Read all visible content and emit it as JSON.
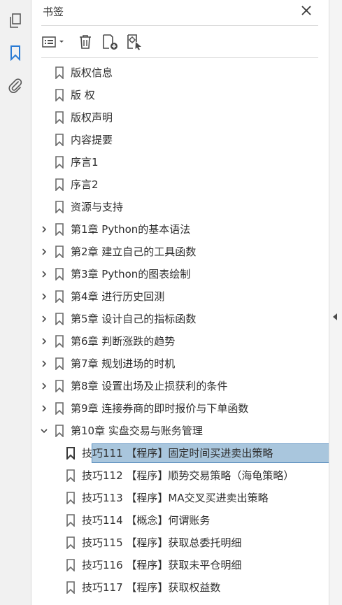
{
  "panel": {
    "title": "书签"
  },
  "rail": {
    "items": [
      {
        "icon": "pages-icon",
        "active": false
      },
      {
        "icon": "bookmark-icon",
        "active": true
      },
      {
        "icon": "attachment-icon",
        "active": false
      }
    ]
  },
  "toolbar": {
    "buttons": [
      "options-menu-icon",
      "delete-bookmark-icon",
      "new-bookmark-icon",
      "new-bookmark-from-structure-icon"
    ]
  },
  "bookmarks": [
    {
      "label": "版权信息",
      "level": 0,
      "expandable": false
    },
    {
      "label": "版 权",
      "level": 0,
      "expandable": false
    },
    {
      "label": "版权声明",
      "level": 0,
      "expandable": false
    },
    {
      "label": "内容提要",
      "level": 0,
      "expandable": false
    },
    {
      "label": "序言1",
      "level": 0,
      "expandable": false
    },
    {
      "label": "序言2",
      "level": 0,
      "expandable": false
    },
    {
      "label": "资源与支持",
      "level": 0,
      "expandable": false
    },
    {
      "label": "第1章 Python的基本语法",
      "level": 0,
      "expandable": true,
      "expanded": false
    },
    {
      "label": "第2章 建立自己的工具函数",
      "level": 0,
      "expandable": true,
      "expanded": false
    },
    {
      "label": "第3章 Python的图表绘制",
      "level": 0,
      "expandable": true,
      "expanded": false
    },
    {
      "label": "第4章 进行历史回测",
      "level": 0,
      "expandable": true,
      "expanded": false
    },
    {
      "label": "第5章 设计自己的指标函数",
      "level": 0,
      "expandable": true,
      "expanded": false
    },
    {
      "label": "第6章 判断涨跌的趋势",
      "level": 0,
      "expandable": true,
      "expanded": false
    },
    {
      "label": "第7章 规划进场的时机",
      "level": 0,
      "expandable": true,
      "expanded": false
    },
    {
      "label": "第8章 设置出场及止损获利的条件",
      "level": 0,
      "expandable": true,
      "expanded": false
    },
    {
      "label": "第9章 连接券商的即时报价与下单函数",
      "level": 0,
      "expandable": true,
      "expanded": false
    },
    {
      "label": "第10章 实盘交易与账务管理",
      "level": 0,
      "expandable": true,
      "expanded": true
    },
    {
      "label": "技巧111 【程序】固定时间买进卖出策略",
      "level": 1,
      "expandable": false,
      "selected": true
    },
    {
      "label": "技巧112 【程序】顺势交易策略（海龟策略）",
      "level": 1,
      "expandable": false
    },
    {
      "label": "技巧113 【程序】MA交叉买进卖出策略",
      "level": 1,
      "expandable": false
    },
    {
      "label": "技巧114 【概念】何谓账务",
      "level": 1,
      "expandable": false
    },
    {
      "label": "技巧115 【程序】获取总委托明细",
      "level": 1,
      "expandable": false
    },
    {
      "label": "技巧116 【程序】获取未平仓明细",
      "level": 1,
      "expandable": false
    },
    {
      "label": "技巧117 【程序】获取权益数",
      "level": 1,
      "expandable": false
    }
  ],
  "colors": {
    "accent": "#2a7bd4",
    "selection": "#a9c6dd",
    "icon": "#5a5a5a"
  }
}
